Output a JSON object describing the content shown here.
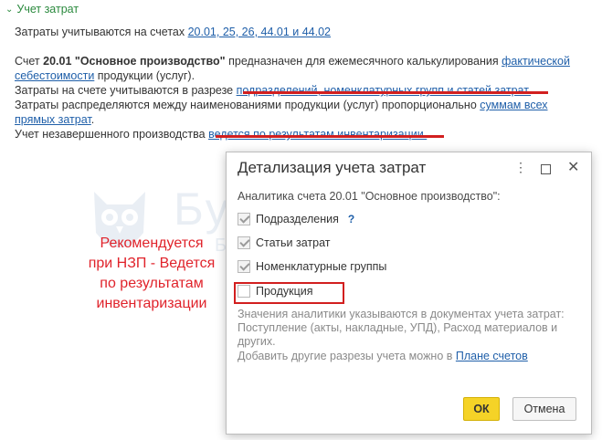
{
  "section": {
    "title": "Учет затрат"
  },
  "line1": {
    "text": "Затраты учитываются на счетах ",
    "link": "20.01, 25, 26, 44.01 и 44.02"
  },
  "para": {
    "l1_pre": "Счет ",
    "l1_bold": "20.01 \"Основное производство\"",
    "l1_post": " предназначен для ежемесячного калькулирования ",
    "l1_link": "фактической",
    "l2_link": "себестоимости",
    "l2_post": " продукции (услуг).",
    "l3_pre": "Затраты на счете учитываются в разрезе ",
    "l3_link": "подразделений, номенклатурных групп и статей затрат.",
    "l4_pre": "Затраты распределяются между наименованиями продукции (услуг) пропорционально ",
    "l4_link": "суммам всех",
    "l5_link": "прямых затрат",
    "l5_post": ".",
    "l6_pre": "Учет незавершенного производства ",
    "l6_link": "ведется по результатам инвентаризации."
  },
  "watermark": {
    "brand": "БухЭксперт",
    "sub": "Базовые знания по учету в 1С",
    "badge": "8"
  },
  "annotation": {
    "text": "Рекомендуется при НЗП - Ведется по результатам инвентаризации"
  },
  "dialog": {
    "title": "Детализация учета затрат",
    "more_icon": "⋮",
    "close_icon": "✕",
    "analytics_label": "Аналитика счета 20.01 \"Основное производство\":",
    "checkboxes": [
      {
        "label": "Подразделения",
        "checked": true,
        "help": "?"
      },
      {
        "label": "Статьи затрат",
        "checked": true
      },
      {
        "label": "Номенклатурные группы",
        "checked": true
      },
      {
        "label": "Продукция",
        "checked": false
      }
    ],
    "info_text": "Значения аналитики указываются в документах учета затрат: Поступление (акты, накладные, УПД), Расход материалов и других.",
    "add_pre": "Добавить другие разрезы учета можно в ",
    "add_link": "Плане счетов",
    "ok_label": "ОК",
    "cancel_label": "Отмена"
  },
  "colors": {
    "accent_green": "#2b8a3e",
    "link_blue": "#1f5fa9",
    "highlight_red": "#d21f1f",
    "ok_yellow": "#f5d327"
  }
}
